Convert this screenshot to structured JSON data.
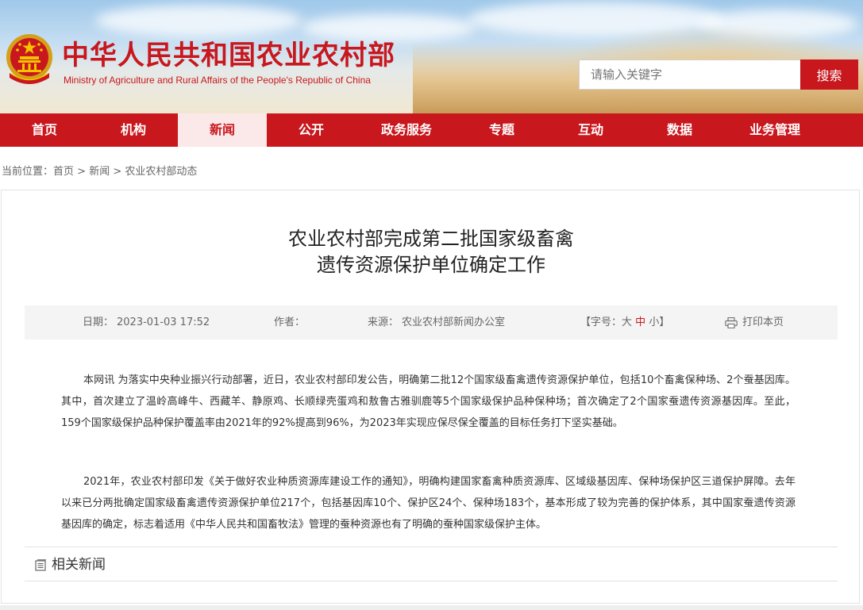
{
  "header": {
    "site_title_cn": "中华人民共和国农业农村部",
    "site_title_en": "Ministry of Agriculture and Rural Affairs of the People's Republic of China",
    "search_placeholder": "请输入关键字",
    "search_button": "搜索"
  },
  "nav": {
    "items": [
      "首页",
      "机构",
      "新闻",
      "公开",
      "政务服务",
      "专题",
      "互动",
      "数据",
      "业务管理"
    ],
    "active_index": 2
  },
  "breadcrumb": {
    "prefix": "当前位置：",
    "items": [
      "首页",
      "新闻",
      "农业农村部动态"
    ],
    "separator": ">"
  },
  "article": {
    "title_line1": "农业农村部完成第二批国家级畜禽",
    "title_line2": "遗传资源保护单位确定工作",
    "meta": {
      "date_label": "日期：",
      "date_value": "2023-01-03 17:52",
      "author_label": "作者：",
      "author_value": "",
      "source_label": "来源：",
      "source_value": "农业农村部新闻办公室",
      "fontsize_open": "【字号：",
      "fontsize_large": "大",
      "fontsize_medium": "中",
      "fontsize_small": "小",
      "fontsize_close": "】",
      "print": "打印本页"
    },
    "paragraphs": [
      "本网讯 为落实中央种业振兴行动部署，近日，农业农村部印发公告，明确第二批12个国家级畜禽遗传资源保护单位，包括10个畜禽保种场、2个蚕基因库。其中，首次建立了温岭高峰牛、西藏羊、静原鸡、长顺绿壳蛋鸡和敖鲁古雅驯鹿等5个国家级保护品种保种场；首次确定了2个国家蚕遗传资源基因库。至此，159个国家级保护品种保护覆盖率由2021年的92%提高到96%，为2023年实现应保尽保全覆盖的目标任务打下坚实基础。",
      "2021年，农业农村部印发《关于做好农业种质资源库建设工作的通知》，明确构建国家畜禽种质资源库、区域级基因库、保种场保护区三道保护屏障。去年以来已分两批确定国家级畜禽遗传资源保护单位217个，包括基因库10个、保护区24个、保种场183个，基本形成了较为完善的保护体系，其中国家蚕遗传资源基因库的确定，标志着适用《中华人民共和国畜牧法》管理的蚕种资源也有了明确的蚕种国家级保护主体。"
    ]
  },
  "related": {
    "title": "相关新闻"
  },
  "colors": {
    "brand_red": "#c8171d",
    "nav_active_bg": "#fbe8e8",
    "meta_bar_bg": "#f4f4f4"
  },
  "icons": {
    "emblem": "national-emblem-icon",
    "print": "printer-icon",
    "related": "document-list-icon"
  }
}
